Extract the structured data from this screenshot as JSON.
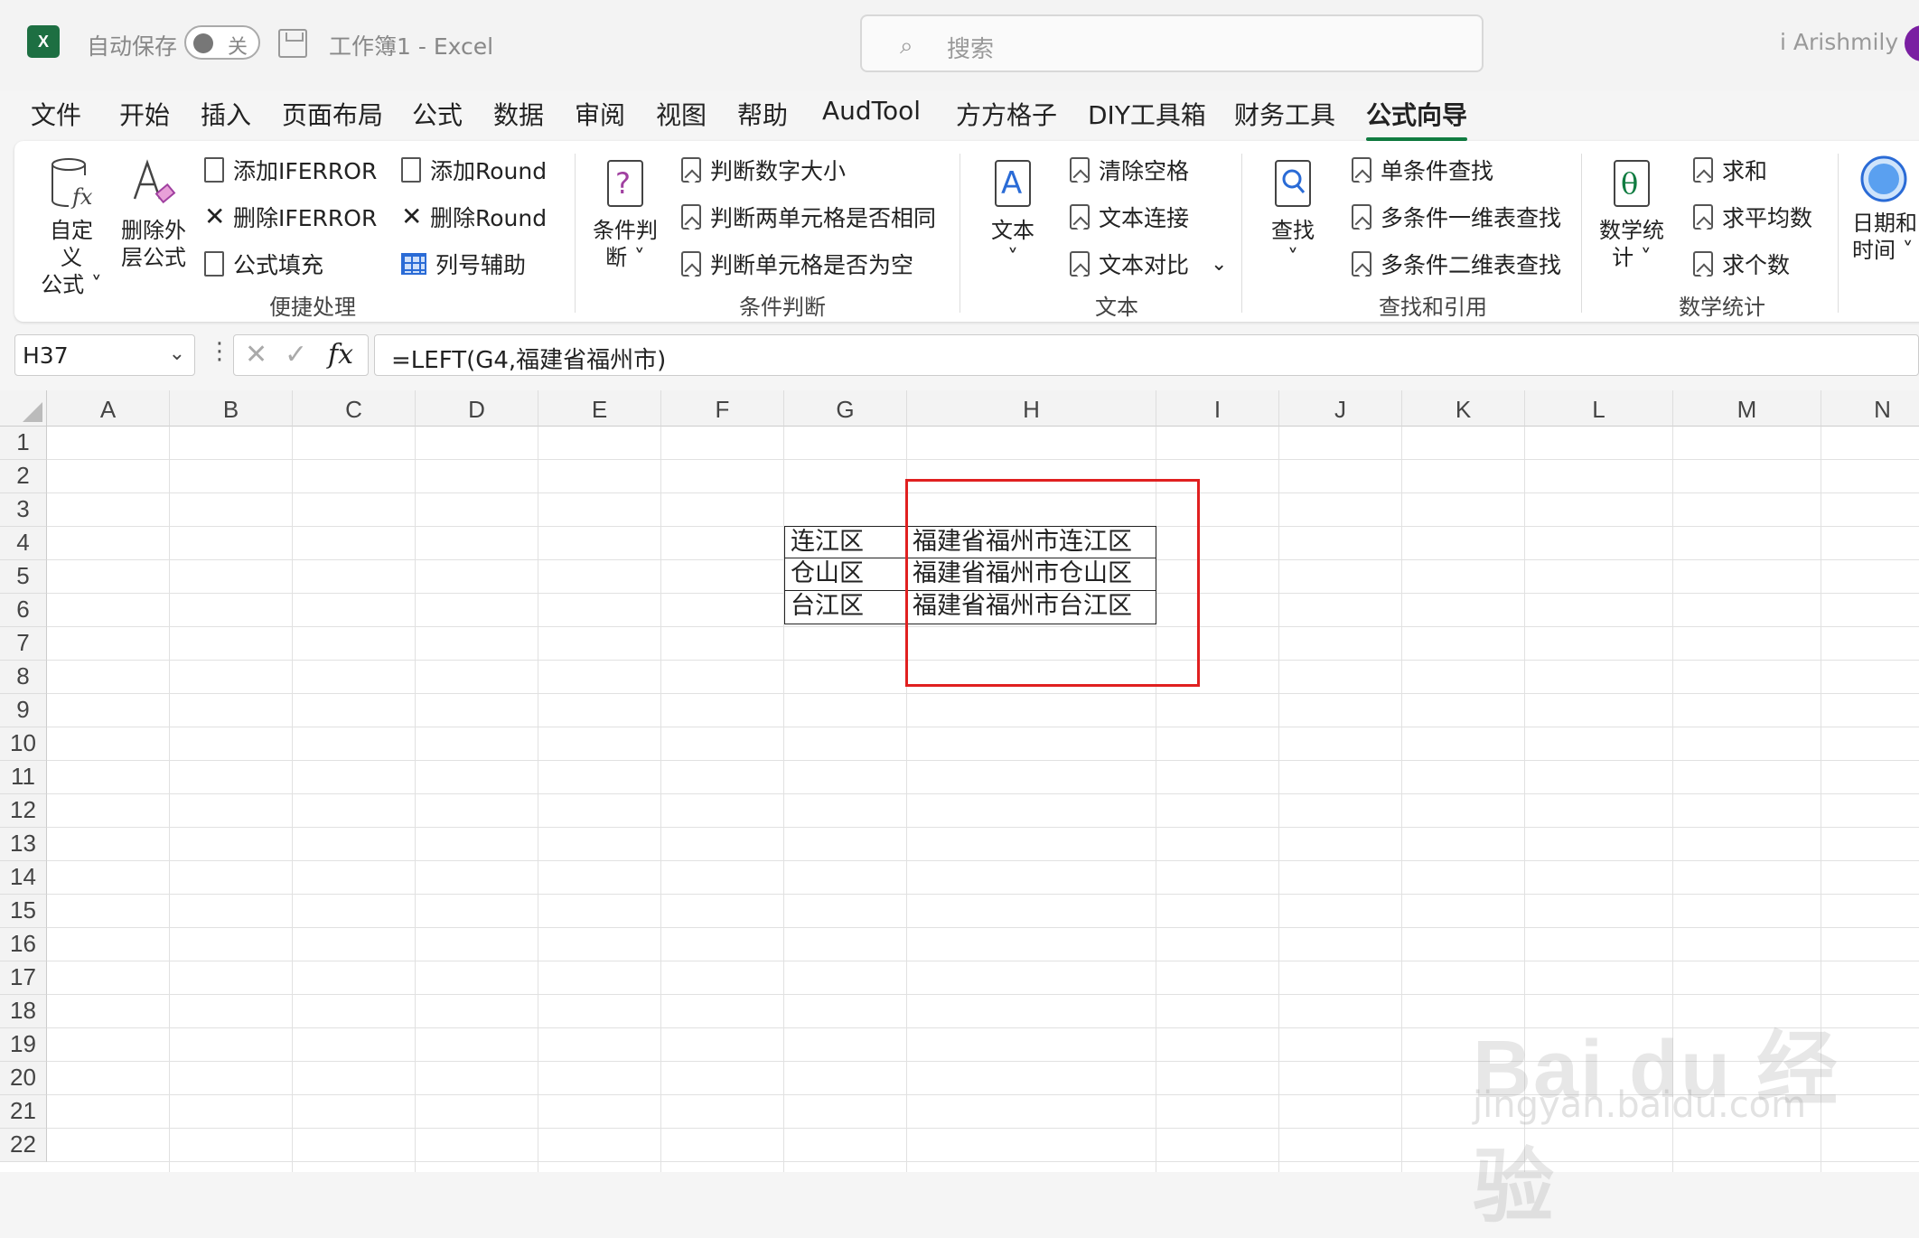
{
  "app": {
    "logo": "X",
    "autosave_label": "自动保存",
    "autosave_state": "关",
    "doc_title": "工作簿1  -  Excel",
    "search_placeholder": "搜索",
    "user_name": "i Arishmily"
  },
  "tabs": [
    "文件",
    "开始",
    "插入",
    "页面布局",
    "公式",
    "数据",
    "审阅",
    "视图",
    "帮助",
    "AudTool",
    "方方格子",
    "DIY工具箱",
    "财务工具",
    "公式向导"
  ],
  "active_tab": "公式向导",
  "ribbon": {
    "quick": {
      "big1": "自定义\n公式 ˅",
      "big2": "删除外\n层公式",
      "items": [
        "添加IFERROR",
        "删除IFERROR",
        "公式填充",
        "添加Round",
        "删除Round",
        "列号辅助"
      ],
      "label": "便捷处理"
    },
    "cond": {
      "big": "条件判\n断 ˅",
      "items": [
        "判断数字大小",
        "判断两单元格是否相同",
        "判断单元格是否为空"
      ],
      "label": "条件判断"
    },
    "text": {
      "big": "文本\n˅",
      "items": [
        "清除空格",
        "文本连接",
        "文本对比"
      ],
      "label": "文本"
    },
    "lookup": {
      "big": "查找\n˅",
      "items": [
        "单条件查找",
        "多条件一维表查找",
        "多条件二维表查找"
      ],
      "label": "查找和引用"
    },
    "math": {
      "big": "数学统\n计 ˅",
      "items": [
        "求和",
        "求平均数",
        "求个数"
      ],
      "label": "数学统计"
    },
    "date": {
      "big": "日期和\n时间 ˅"
    }
  },
  "formula_bar": {
    "name_box": "H37",
    "formula": "=LEFT(G4,福建省福州市)"
  },
  "sheet": {
    "columns": [
      "A",
      "B",
      "C",
      "D",
      "E",
      "F",
      "G",
      "H",
      "I",
      "J",
      "K",
      "L",
      "M",
      "N"
    ],
    "rows": [
      "1",
      "2",
      "3",
      "4",
      "5",
      "6",
      "7",
      "8",
      "9",
      "10",
      "11",
      "12",
      "13",
      "14",
      "15",
      "16",
      "17",
      "18",
      "19",
      "20",
      "21",
      "22"
    ],
    "cells": {
      "G4": "连江区",
      "G5": "仓山区",
      "G6": "台江区",
      "H4": "福建省福州市连江区",
      "H5": "福建省福州市仓山区",
      "H6": "福建省福州市台江区"
    }
  },
  "watermark": {
    "brand": "Bai du 经验",
    "url": "jingyan.baidu.com"
  },
  "colors": {
    "excel_green": "#107c41",
    "highlight_red": "#e02020"
  }
}
